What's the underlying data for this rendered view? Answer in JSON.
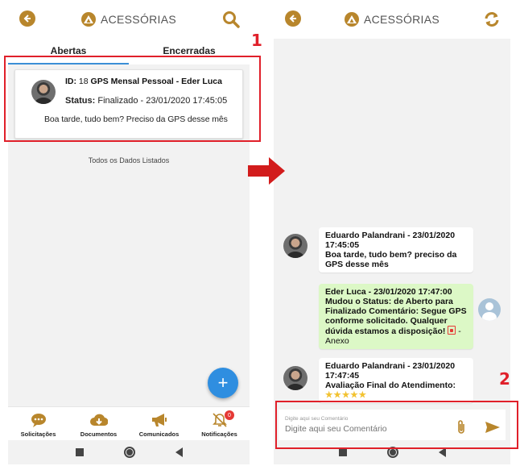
{
  "colors": {
    "accent": "#b8862c",
    "primary_blue": "#2f8ee0",
    "annotation_red": "#e0202a",
    "chat_green": "#dcf8c6"
  },
  "left_screen": {
    "title": "ACESSÓRIAS",
    "back_icon": "arrow-left-icon",
    "search_icon": "search-icon",
    "tabs": [
      {
        "label": "Abertas",
        "active": true
      },
      {
        "label": "Encerradas",
        "active": false
      }
    ],
    "card": {
      "id_label": "ID:",
      "id_value": "18",
      "subject": "GPS Mensal Pessoal - Eder Luca",
      "status_label": "Status:",
      "status_value": "Finalizado - 23/01/2020 17:45:05",
      "message": "Boa tarde, tudo bem? Preciso da GPS desse mês"
    },
    "all_listed": "Todos os Dados Listados",
    "fab_icon": "+",
    "bottom_nav": [
      {
        "label": "Solicitações",
        "icon": "chat-bubble-icon"
      },
      {
        "label": "Documentos",
        "icon": "cloud-download-icon"
      },
      {
        "label": "Comunicados",
        "icon": "megaphone-icon"
      },
      {
        "label": "Notificações",
        "icon": "bell-off-icon",
        "badge": "0"
      }
    ]
  },
  "right_screen": {
    "title": "ACESSÓRIAS",
    "refresh_icon": "refresh-icon",
    "messages": [
      {
        "header": "Eduardo Palandrani - 23/01/2020 17:45:05",
        "text": "Boa tarde, tudo bem? preciso da GPS desse mês"
      },
      {
        "header": "Eder Luca - 23/01/2020 17:47:00",
        "text": "Mudou o Status: de Aberto para Finalizado Comentário: Segue GPS conforme solicitado. Qualquer dúvida estamos a disposição!",
        "attachment_suffix": " -",
        "attachment_label": "Anexo"
      },
      {
        "header": "Eduardo Palandrani - 23/01/2020 17:47:45",
        "text": "Avaliação Final do Atendimento:",
        "stars": "★★★★★"
      }
    ],
    "comment": {
      "label": "Digite aqui seu Comentário",
      "placeholder": "Digite aqui seu Comentário"
    }
  },
  "annotations": {
    "one": "1",
    "two": "2"
  }
}
